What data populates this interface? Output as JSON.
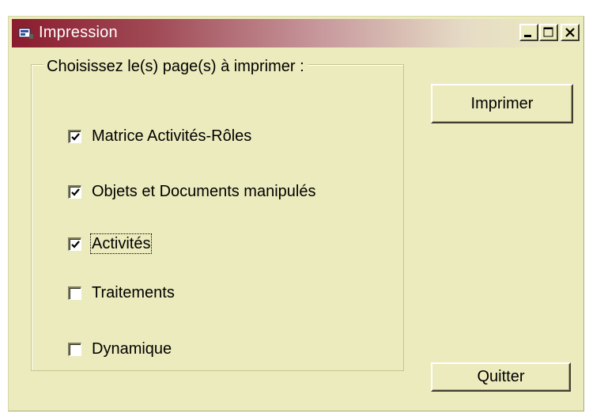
{
  "window": {
    "title": "Impression",
    "icon": "printer-app-icon",
    "caption_buttons": [
      "minimize",
      "maximize",
      "close"
    ]
  },
  "group": {
    "legend": "Choisissez le(s) page(s) à imprimer :"
  },
  "options": [
    {
      "label": "Matrice Activités-Rôles",
      "checked": true
    },
    {
      "label": "Objets et Documents manipulés",
      "checked": true
    },
    {
      "label": "Activités",
      "checked": true,
      "focused": true
    },
    {
      "label": "Traitements",
      "checked": false
    },
    {
      "label": "Dynamique",
      "checked": false
    }
  ],
  "buttons": {
    "print_label": "Imprimer",
    "quit_label": "Quitter"
  },
  "colors": {
    "window_bg": "#ecebbd",
    "titlebar_start": "#8a1c2e",
    "titlebar_end": "#ecebbd",
    "title_text": "#ffffff"
  }
}
